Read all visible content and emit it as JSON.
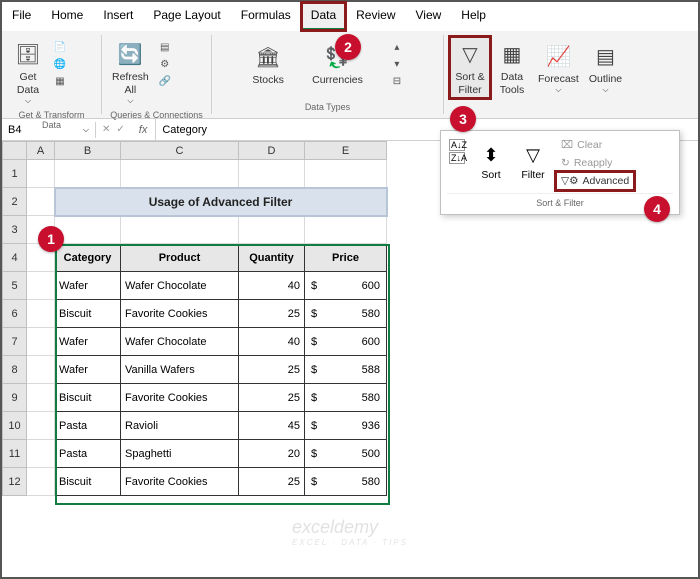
{
  "menu": {
    "items": [
      "File",
      "Home",
      "Insert",
      "Page Layout",
      "Formulas",
      "Data",
      "Review",
      "View",
      "Help"
    ],
    "active": "Data"
  },
  "ribbon": {
    "group1": {
      "label": "Get & Transform Data",
      "btn1": "Get\nData",
      "btn1_caret": "⌵"
    },
    "group2": {
      "label": "Queries & Connections",
      "btn1": "Refresh\nAll",
      "btn1_caret": "⌵"
    },
    "group3": {
      "label": "Data Types",
      "btn1": "Stocks",
      "btn2": "Currencies"
    },
    "group4": {
      "btn1": "Sort &\nFilter",
      "btn1_caret": "⌵",
      "btn2": "Data\nTools",
      "btn2_caret": "⌵",
      "btn3": "Forecast",
      "btn3_caret": "⌵",
      "btn4": "Outline",
      "btn4_caret": "⌵"
    }
  },
  "dropdown": {
    "az": "A→Z",
    "za": "Z→A",
    "sort": "Sort",
    "filter": "Filter",
    "clear": "Clear",
    "reapply": "Reapply",
    "advanced": "Advanced",
    "footer": "Sort & Filter"
  },
  "namebox": "B4",
  "formula": "Category",
  "fx_label": "fx",
  "callouts": {
    "c1": "1",
    "c2": "2",
    "c3": "3",
    "c4": "4"
  },
  "sheet": {
    "cols": [
      "A",
      "B",
      "C",
      "D",
      "E"
    ],
    "title": "Usage of Advanced Filter",
    "headers": [
      "Category",
      "Product",
      "Quantity",
      "Price"
    ],
    "rows": [
      {
        "cat": "Wafer",
        "prod": "Wafer Chocolate",
        "qty": "40",
        "cur": "$",
        "price": "600"
      },
      {
        "cat": "Biscuit",
        "prod": "Favorite Cookies",
        "qty": "25",
        "cur": "$",
        "price": "580"
      },
      {
        "cat": "Wafer",
        "prod": "Wafer Chocolate",
        "qty": "40",
        "cur": "$",
        "price": "600"
      },
      {
        "cat": "Wafer",
        "prod": "Vanilla Wafers",
        "qty": "25",
        "cur": "$",
        "price": "588"
      },
      {
        "cat": "Biscuit",
        "prod": "Favorite Cookies",
        "qty": "25",
        "cur": "$",
        "price": "580"
      },
      {
        "cat": "Pasta",
        "prod": "Ravioli",
        "qty": "45",
        "cur": "$",
        "price": "936"
      },
      {
        "cat": "Pasta",
        "prod": "Spaghetti",
        "qty": "20",
        "cur": "$",
        "price": "500"
      },
      {
        "cat": "Biscuit",
        "prod": "Favorite Cookies",
        "qty": "25",
        "cur": "$",
        "price": "580"
      }
    ]
  },
  "watermark": {
    "main": "exceldemy",
    "sub": "EXCEL · DATA · TIPS"
  }
}
